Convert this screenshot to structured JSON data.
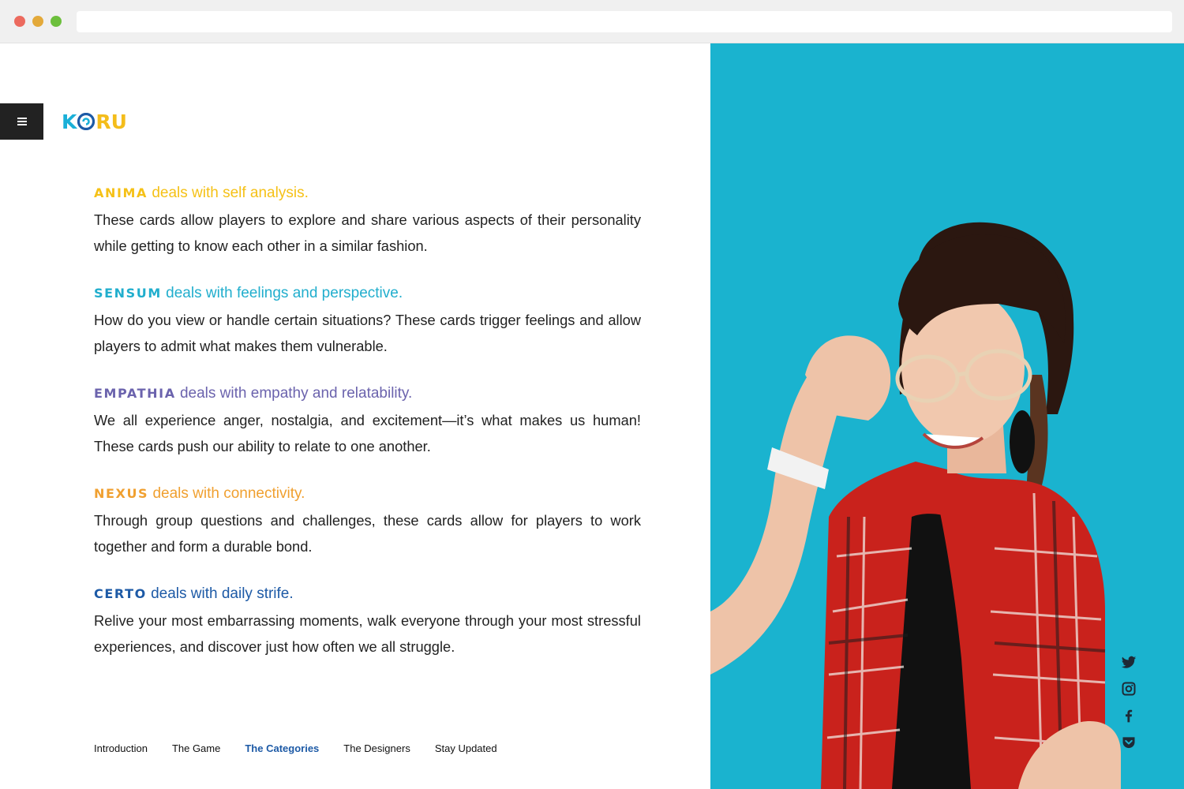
{
  "brand": {
    "logo_k": "K",
    "logo_ru": "RU"
  },
  "categories": [
    {
      "name": "ANIMA",
      "tagline": "deals with self analysis.",
      "description": "These cards allow players to explore and share various aspects of their personality while getting to know each other in a similar fashion.",
      "color": "#f5c117"
    },
    {
      "name": "SENSUM",
      "tagline": "deals with feelings and perspective.",
      "description": "How do you view or handle certain situations? These cards trigger feelings and allow players to admit what makes them vulnerable.",
      "color": "#21aecd"
    },
    {
      "name": "EMPATHIA",
      "tagline": "deals with empathy and relatability.",
      "description": "We all experience anger, nostalgia, and excitement—it’s what makes us human! These cards push our ability to relate to one another.",
      "color": "#6b63ad"
    },
    {
      "name": "NEXUS",
      "tagline": "deals with connectivity.",
      "description": "Through group questions and challenges, these cards allow for players to work together and form a durable bond.",
      "color": "#f0a030"
    },
    {
      "name": "CERTO",
      "tagline": "deals with daily strife.",
      "description": "Relive your most embarrassing moments, walk everyone through your most stressful experiences, and discover just how often we all struggle.",
      "color": "#1d5aa6"
    }
  ],
  "footer_nav": {
    "items": [
      {
        "label": "Introduction",
        "active": false
      },
      {
        "label": "The Game",
        "active": false
      },
      {
        "label": "The Categories",
        "active": true
      },
      {
        "label": "The Designers",
        "active": false
      },
      {
        "label": "Stay Updated",
        "active": false
      }
    ],
    "active_color": "#1d5aa6"
  },
  "social": {
    "icons": [
      "twitter-icon",
      "instagram-icon",
      "facebook-icon",
      "pocket-icon"
    ]
  },
  "photo": {
    "background_color": "#1ab3cf"
  }
}
